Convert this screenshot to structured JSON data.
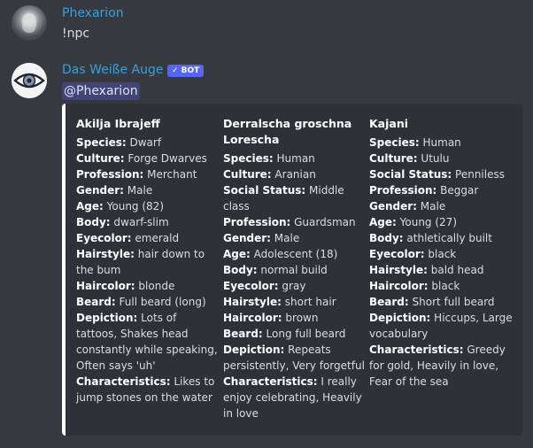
{
  "messages": [
    {
      "username": "Phexarion",
      "content": "!npc"
    },
    {
      "username": "Das Weiße Auge",
      "bot_tag": "✓ BOT",
      "mention": "@Phexarion"
    }
  ],
  "embed": {
    "accent_color": "#ffffff",
    "columns": [
      {
        "name": "Akilja Ibrajeff",
        "fields": [
          {
            "label": "Species:",
            "value": "Dwarf"
          },
          {
            "label": "Culture:",
            "value": "Forge Dwarves"
          },
          {
            "label": "Profession:",
            "value": "Merchant"
          },
          {
            "label": "Gender:",
            "value": "Male"
          },
          {
            "label": "Age:",
            "value": "Young (82)"
          },
          {
            "label": "Body:",
            "value": "dwarf-slim"
          },
          {
            "label": "Eyecolor:",
            "value": "emerald"
          },
          {
            "label": "Hairstyle:",
            "value": "hair down to the bum"
          },
          {
            "label": "Haircolor:",
            "value": "blonde"
          },
          {
            "label": "Beard:",
            "value": "Full beard (long)"
          },
          {
            "label": "Depiction:",
            "value": "Lots of tattoos, Shakes head constantly while speaking, Often says 'uh'"
          },
          {
            "label": "Characteristics:",
            "value": "Likes to jump stones on the water"
          }
        ]
      },
      {
        "name": "Derralscha groschna Lorescha",
        "fields": [
          {
            "label": "Species:",
            "value": "Human"
          },
          {
            "label": "Culture:",
            "value": "Aranian"
          },
          {
            "label": "Social Status:",
            "value": "Middle class"
          },
          {
            "label": "Profession:",
            "value": "Guardsman"
          },
          {
            "label": "Gender:",
            "value": "Male"
          },
          {
            "label": "Age:",
            "value": "Adolescent (18)"
          },
          {
            "label": "Body:",
            "value": "normal build"
          },
          {
            "label": "Eyecolor:",
            "value": "gray"
          },
          {
            "label": "Hairstyle:",
            "value": "short hair"
          },
          {
            "label": "Haircolor:",
            "value": "brown"
          },
          {
            "label": "Beard:",
            "value": "Long full beard"
          },
          {
            "label": "Depiction:",
            "value": "Repeats persistently, Very forgetful"
          },
          {
            "label": "Characteristics:",
            "value": "I really enjoy celebrating, Heavily in love"
          }
        ]
      },
      {
        "name": "Kajani",
        "fields": [
          {
            "label": "Species:",
            "value": "Human"
          },
          {
            "label": "Culture:",
            "value": "Utulu"
          },
          {
            "label": "Social Status:",
            "value": "Penniless"
          },
          {
            "label": "Profession:",
            "value": "Beggar"
          },
          {
            "label": "Gender:",
            "value": "Male"
          },
          {
            "label": "Age:",
            "value": "Young (27)"
          },
          {
            "label": "Body:",
            "value": "athletically built"
          },
          {
            "label": "Eyecolor:",
            "value": "black"
          },
          {
            "label": "Hairstyle:",
            "value": "bald head"
          },
          {
            "label": "Haircolor:",
            "value": "black"
          },
          {
            "label": "Beard:",
            "value": "Short full beard"
          },
          {
            "label": "Depiction:",
            "value": "Hiccups, Large vocabulary"
          },
          {
            "label": "Characteristics:",
            "value": "Greedy for gold, Heavily in love, Fear of the sea"
          }
        ]
      }
    ]
  },
  "icons": {
    "user_avatar": "avatar-icon",
    "bot_avatar": "eye-avatar-icon",
    "bot_check": "check-icon"
  }
}
